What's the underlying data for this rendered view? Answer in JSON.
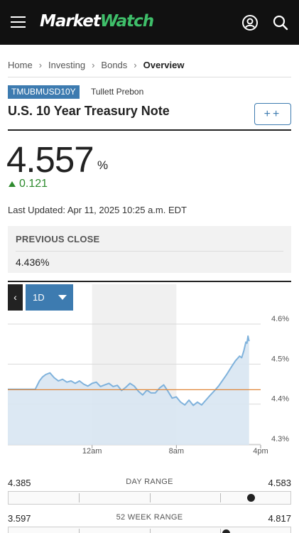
{
  "header": {
    "logo_part1": "Market",
    "logo_part2": "Watch",
    "menu_icon": "hamburger-menu-icon",
    "account_icon": "user-account-icon",
    "search_icon": "search-icon"
  },
  "breadcrumb": {
    "items": [
      "Home",
      "Investing",
      "Bonds",
      "Overview"
    ]
  },
  "instrument": {
    "ticker": "TMUBMUSD10Y",
    "source": "Tullett Prebon",
    "name": "U.S. 10 Year Treasury Note",
    "watch_label": "++",
    "price": "4.557",
    "price_unit": "%",
    "change": "0.121",
    "change_direction": "up",
    "last_updated": "Last Updated: Apr 11, 2025 10:25 a.m. EDT"
  },
  "previous_close": {
    "label": "PREVIOUS CLOSE",
    "value": "4.436%"
  },
  "chart_controls": {
    "back_label": "‹",
    "range_label": "1D"
  },
  "chart_data": {
    "type": "area",
    "range": "1D",
    "x_tick_labels": [
      "12am",
      "8am",
      "4pm"
    ],
    "y_tick_labels": [
      "4.6%",
      "4.5%",
      "4.4%",
      "4.3%"
    ],
    "ylim": [
      4.3,
      4.6
    ],
    "previous_close_line": 4.436,
    "x_unit": "hours since 4pm prior day",
    "x_span": [
      0,
      24
    ],
    "session_shading": {
      "start": 8.0,
      "end": 16.0
    },
    "series": [
      {
        "values": [
          [
            0.0,
            4.437
          ],
          [
            2.6,
            4.437
          ],
          [
            3.0,
            4.458
          ],
          [
            3.3,
            4.468
          ],
          [
            3.6,
            4.474
          ],
          [
            4.0,
            4.478
          ],
          [
            4.4,
            4.466
          ],
          [
            4.8,
            4.458
          ],
          [
            5.2,
            4.462
          ],
          [
            5.6,
            4.455
          ],
          [
            6.0,
            4.458
          ],
          [
            6.4,
            4.452
          ],
          [
            6.8,
            4.458
          ],
          [
            7.2,
            4.45
          ],
          [
            7.6,
            4.445
          ],
          [
            8.0,
            4.452
          ],
          [
            8.4,
            4.455
          ],
          [
            8.8,
            4.444
          ],
          [
            9.2,
            4.448
          ],
          [
            9.6,
            4.452
          ],
          [
            10.0,
            4.444
          ],
          [
            10.4,
            4.447
          ],
          [
            10.8,
            4.434
          ],
          [
            11.2,
            4.442
          ],
          [
            11.6,
            4.452
          ],
          [
            12.0,
            4.445
          ],
          [
            12.4,
            4.432
          ],
          [
            12.8,
            4.423
          ],
          [
            13.2,
            4.435
          ],
          [
            13.6,
            4.428
          ],
          [
            14.0,
            4.428
          ],
          [
            14.4,
            4.44
          ],
          [
            14.8,
            4.448
          ],
          [
            15.2,
            4.432
          ],
          [
            15.6,
            4.415
          ],
          [
            16.0,
            4.418
          ],
          [
            16.4,
            4.405
          ],
          [
            16.8,
            4.398
          ],
          [
            17.2,
            4.41
          ],
          [
            17.6,
            4.397
          ],
          [
            18.0,
            4.405
          ],
          [
            18.4,
            4.398
          ],
          [
            18.8,
            4.41
          ],
          [
            19.2,
            4.422
          ],
          [
            19.6,
            4.433
          ],
          [
            20.0,
            4.445
          ],
          [
            20.4,
            4.46
          ],
          [
            20.8,
            4.475
          ],
          [
            21.2,
            4.492
          ],
          [
            21.6,
            4.508
          ],
          [
            22.0,
            4.52
          ],
          [
            22.2,
            4.516
          ],
          [
            22.4,
            4.533
          ],
          [
            22.6,
            4.555
          ],
          [
            22.7,
            4.552
          ],
          [
            22.8,
            4.57
          ],
          [
            22.9,
            4.557
          ]
        ]
      }
    ]
  },
  "day_range": {
    "label": "DAY RANGE",
    "low": "4.385",
    "high": "4.583",
    "position": 0.86
  },
  "week52_range": {
    "label": "52 WEEK RANGE",
    "low": "3.597",
    "high": "4.817",
    "position": 0.77
  }
}
